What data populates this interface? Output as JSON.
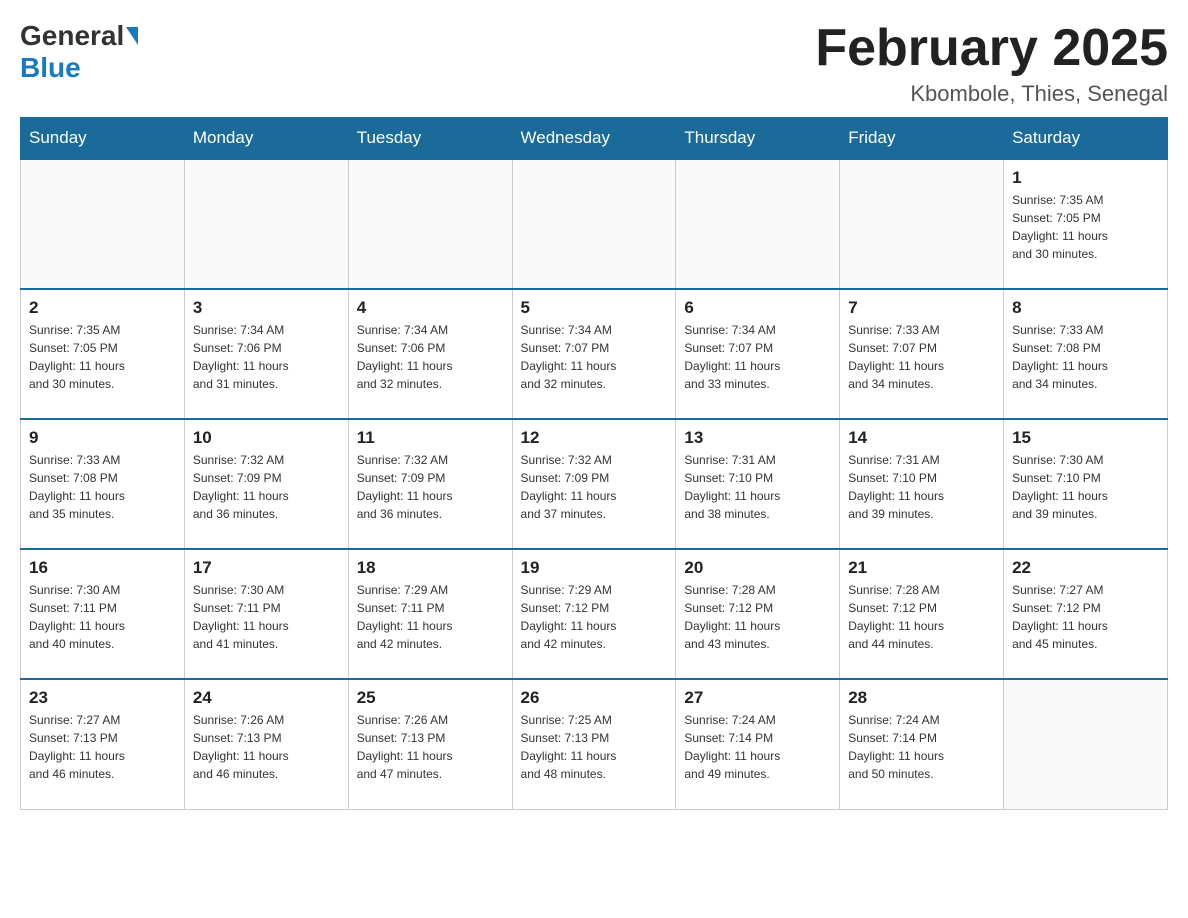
{
  "header": {
    "logo_general": "General",
    "logo_blue": "Blue",
    "month_title": "February 2025",
    "location": "Kbombole, Thies, Senegal"
  },
  "days_of_week": [
    "Sunday",
    "Monday",
    "Tuesday",
    "Wednesday",
    "Thursday",
    "Friday",
    "Saturday"
  ],
  "weeks": [
    [
      {
        "day": "",
        "info": ""
      },
      {
        "day": "",
        "info": ""
      },
      {
        "day": "",
        "info": ""
      },
      {
        "day": "",
        "info": ""
      },
      {
        "day": "",
        "info": ""
      },
      {
        "day": "",
        "info": ""
      },
      {
        "day": "1",
        "info": "Sunrise: 7:35 AM\nSunset: 7:05 PM\nDaylight: 11 hours\nand 30 minutes."
      }
    ],
    [
      {
        "day": "2",
        "info": "Sunrise: 7:35 AM\nSunset: 7:05 PM\nDaylight: 11 hours\nand 30 minutes."
      },
      {
        "day": "3",
        "info": "Sunrise: 7:34 AM\nSunset: 7:06 PM\nDaylight: 11 hours\nand 31 minutes."
      },
      {
        "day": "4",
        "info": "Sunrise: 7:34 AM\nSunset: 7:06 PM\nDaylight: 11 hours\nand 32 minutes."
      },
      {
        "day": "5",
        "info": "Sunrise: 7:34 AM\nSunset: 7:07 PM\nDaylight: 11 hours\nand 32 minutes."
      },
      {
        "day": "6",
        "info": "Sunrise: 7:34 AM\nSunset: 7:07 PM\nDaylight: 11 hours\nand 33 minutes."
      },
      {
        "day": "7",
        "info": "Sunrise: 7:33 AM\nSunset: 7:07 PM\nDaylight: 11 hours\nand 34 minutes."
      },
      {
        "day": "8",
        "info": "Sunrise: 7:33 AM\nSunset: 7:08 PM\nDaylight: 11 hours\nand 34 minutes."
      }
    ],
    [
      {
        "day": "9",
        "info": "Sunrise: 7:33 AM\nSunset: 7:08 PM\nDaylight: 11 hours\nand 35 minutes."
      },
      {
        "day": "10",
        "info": "Sunrise: 7:32 AM\nSunset: 7:09 PM\nDaylight: 11 hours\nand 36 minutes."
      },
      {
        "day": "11",
        "info": "Sunrise: 7:32 AM\nSunset: 7:09 PM\nDaylight: 11 hours\nand 36 minutes."
      },
      {
        "day": "12",
        "info": "Sunrise: 7:32 AM\nSunset: 7:09 PM\nDaylight: 11 hours\nand 37 minutes."
      },
      {
        "day": "13",
        "info": "Sunrise: 7:31 AM\nSunset: 7:10 PM\nDaylight: 11 hours\nand 38 minutes."
      },
      {
        "day": "14",
        "info": "Sunrise: 7:31 AM\nSunset: 7:10 PM\nDaylight: 11 hours\nand 39 minutes."
      },
      {
        "day": "15",
        "info": "Sunrise: 7:30 AM\nSunset: 7:10 PM\nDaylight: 11 hours\nand 39 minutes."
      }
    ],
    [
      {
        "day": "16",
        "info": "Sunrise: 7:30 AM\nSunset: 7:11 PM\nDaylight: 11 hours\nand 40 minutes."
      },
      {
        "day": "17",
        "info": "Sunrise: 7:30 AM\nSunset: 7:11 PM\nDaylight: 11 hours\nand 41 minutes."
      },
      {
        "day": "18",
        "info": "Sunrise: 7:29 AM\nSunset: 7:11 PM\nDaylight: 11 hours\nand 42 minutes."
      },
      {
        "day": "19",
        "info": "Sunrise: 7:29 AM\nSunset: 7:12 PM\nDaylight: 11 hours\nand 42 minutes."
      },
      {
        "day": "20",
        "info": "Sunrise: 7:28 AM\nSunset: 7:12 PM\nDaylight: 11 hours\nand 43 minutes."
      },
      {
        "day": "21",
        "info": "Sunrise: 7:28 AM\nSunset: 7:12 PM\nDaylight: 11 hours\nand 44 minutes."
      },
      {
        "day": "22",
        "info": "Sunrise: 7:27 AM\nSunset: 7:12 PM\nDaylight: 11 hours\nand 45 minutes."
      }
    ],
    [
      {
        "day": "23",
        "info": "Sunrise: 7:27 AM\nSunset: 7:13 PM\nDaylight: 11 hours\nand 46 minutes."
      },
      {
        "day": "24",
        "info": "Sunrise: 7:26 AM\nSunset: 7:13 PM\nDaylight: 11 hours\nand 46 minutes."
      },
      {
        "day": "25",
        "info": "Sunrise: 7:26 AM\nSunset: 7:13 PM\nDaylight: 11 hours\nand 47 minutes."
      },
      {
        "day": "26",
        "info": "Sunrise: 7:25 AM\nSunset: 7:13 PM\nDaylight: 11 hours\nand 48 minutes."
      },
      {
        "day": "27",
        "info": "Sunrise: 7:24 AM\nSunset: 7:14 PM\nDaylight: 11 hours\nand 49 minutes."
      },
      {
        "day": "28",
        "info": "Sunrise: 7:24 AM\nSunset: 7:14 PM\nDaylight: 11 hours\nand 50 minutes."
      },
      {
        "day": "",
        "info": ""
      }
    ]
  ]
}
